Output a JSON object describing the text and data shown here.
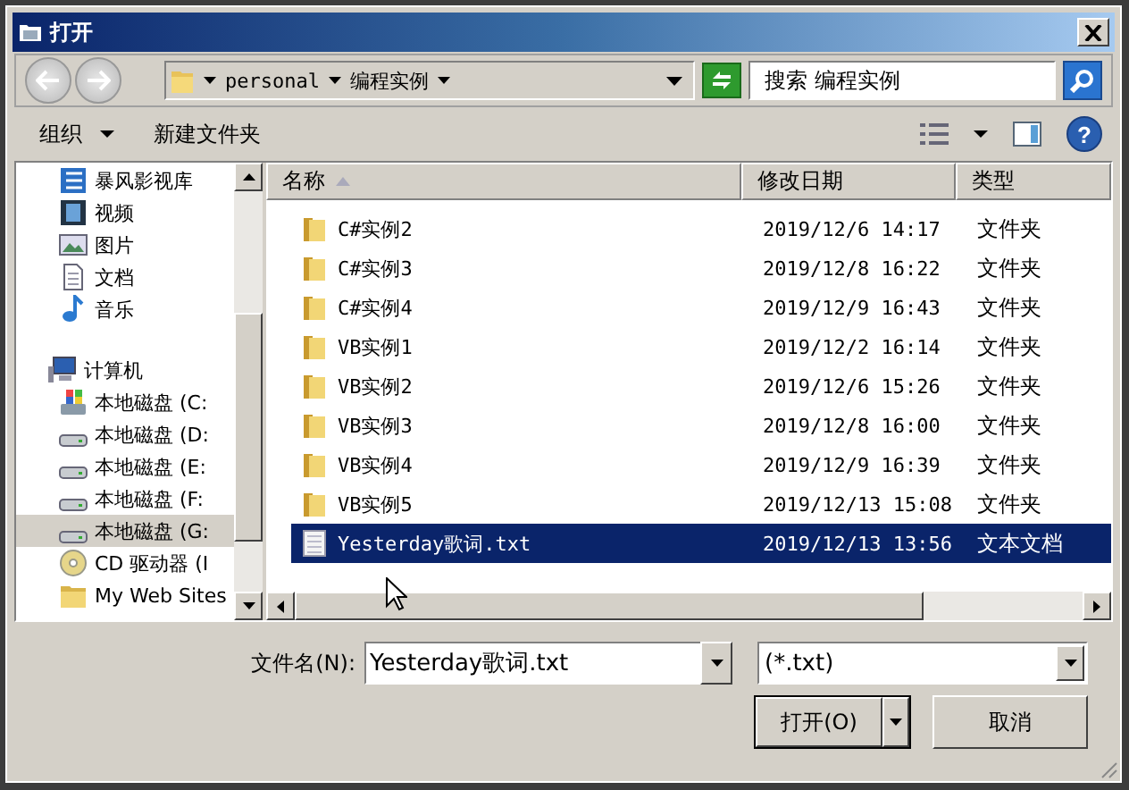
{
  "window": {
    "title": "打开"
  },
  "nav": {
    "path": [
      {
        "label": "personal"
      },
      {
        "label": "编程实例"
      }
    ],
    "search": {
      "placeholder": "搜索 编程实例"
    }
  },
  "toolbar": {
    "organize": "组织",
    "new_folder": "新建文件夹",
    "help": "?"
  },
  "sidebar": {
    "items": [
      {
        "label": "暴风影视库",
        "kind": "library",
        "selected": false
      },
      {
        "label": "视频",
        "kind": "video",
        "selected": false
      },
      {
        "label": "图片",
        "kind": "picture",
        "selected": false
      },
      {
        "label": "文档",
        "kind": "document",
        "selected": false
      },
      {
        "label": "音乐",
        "kind": "music",
        "selected": false
      },
      {
        "label": "计算机",
        "kind": "computer",
        "selected": false,
        "children": [
          {
            "label": "本地磁盘 (C:",
            "kind": "system-drive",
            "selected": false
          },
          {
            "label": "本地磁盘 (D:",
            "kind": "drive",
            "selected": false
          },
          {
            "label": "本地磁盘 (E:",
            "kind": "drive",
            "selected": false
          },
          {
            "label": "本地磁盘 (F:",
            "kind": "drive",
            "selected": false
          },
          {
            "label": "本地磁盘 (G:",
            "kind": "drive",
            "selected": true
          },
          {
            "label": "CD 驱动器 (I",
            "kind": "cd",
            "selected": false
          },
          {
            "label": "My Web Sites",
            "kind": "folder",
            "selected": false
          }
        ]
      }
    ]
  },
  "table": {
    "columns": [
      {
        "label": "名称",
        "sorted": true
      },
      {
        "label": "修改日期"
      },
      {
        "label": "类型"
      }
    ],
    "rows": [
      {
        "name": "C#实例2",
        "date": "2019/12/6 14:17",
        "type": "文件夹",
        "kind": "folder",
        "selected": false
      },
      {
        "name": "C#实例3",
        "date": "2019/12/8 16:22",
        "type": "文件夹",
        "kind": "folder",
        "selected": false
      },
      {
        "name": "C#实例4",
        "date": "2019/12/9 16:43",
        "type": "文件夹",
        "kind": "folder",
        "selected": false
      },
      {
        "name": "VB实例1",
        "date": "2019/12/2 16:14",
        "type": "文件夹",
        "kind": "folder",
        "selected": false
      },
      {
        "name": "VB实例2",
        "date": "2019/12/6 15:26",
        "type": "文件夹",
        "kind": "folder",
        "selected": false
      },
      {
        "name": "VB实例3",
        "date": "2019/12/8 16:00",
        "type": "文件夹",
        "kind": "folder",
        "selected": false
      },
      {
        "name": "VB实例4",
        "date": "2019/12/9 16:39",
        "type": "文件夹",
        "kind": "folder",
        "selected": false
      },
      {
        "name": "VB实例5",
        "date": "2019/12/13 15:08",
        "type": "文件夹",
        "kind": "folder",
        "selected": false
      },
      {
        "name": "Yesterday歌词.txt",
        "date": "2019/12/13 13:56",
        "type": "文本文档",
        "kind": "text",
        "selected": true
      }
    ]
  },
  "filename": {
    "label": "文件名(N):",
    "value": "Yesterday歌词.txt"
  },
  "filter": {
    "value": "(*.txt)"
  },
  "buttons": [
    {
      "label": "打开(O)",
      "kind": "split"
    },
    {
      "label": "取消",
      "kind": "plain"
    }
  ]
}
